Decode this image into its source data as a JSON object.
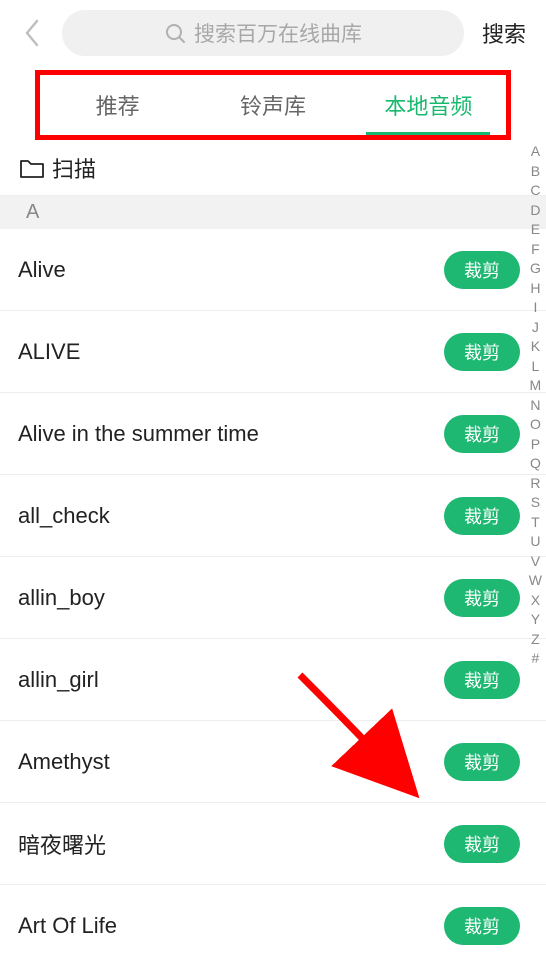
{
  "header": {
    "search_placeholder": "搜索百万在线曲库",
    "search_button": "搜索"
  },
  "tabs": {
    "recommend": "推荐",
    "library": "铃声库",
    "local": "本地音频"
  },
  "scan": {
    "label": "扫描"
  },
  "section": {
    "letter": "A"
  },
  "songs": [
    {
      "title": "Alive",
      "action": "裁剪"
    },
    {
      "title": "ALIVE",
      "action": "裁剪"
    },
    {
      "title": "Alive in the summer time",
      "action": "裁剪"
    },
    {
      "title": "all_check",
      "action": "裁剪"
    },
    {
      "title": "allin_boy",
      "action": "裁剪"
    },
    {
      "title": "allin_girl",
      "action": "裁剪"
    },
    {
      "title": "Amethyst",
      "action": "裁剪"
    },
    {
      "title": "暗夜曙光",
      "action": "裁剪"
    },
    {
      "title": "Art Of Life",
      "action": "裁剪"
    }
  ],
  "index_letters": [
    "A",
    "B",
    "C",
    "D",
    "E",
    "F",
    "G",
    "H",
    "I",
    "J",
    "K",
    "L",
    "M",
    "N",
    "O",
    "P",
    "Q",
    "R",
    "S",
    "T",
    "U",
    "V",
    "W",
    "X",
    "Y",
    "Z",
    "#"
  ]
}
